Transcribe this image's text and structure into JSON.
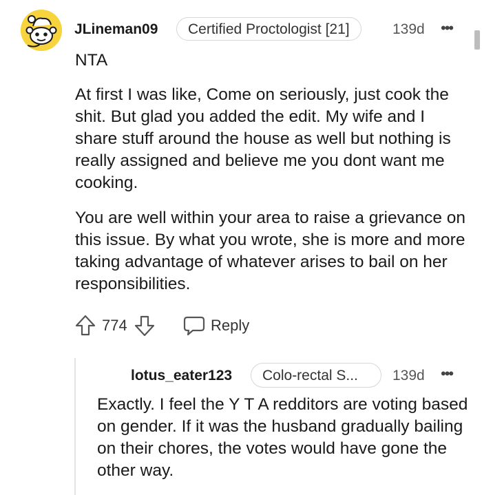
{
  "comment": {
    "username": "JLineman09",
    "flair": "Certified Proctologist [21]",
    "age": "139d",
    "more_label": "•••",
    "paragraphs": [
      "NTA",
      "At first I was like, Come on seriously, just cook the shit. But glad you added the edit. My wife and I share stuff around the house as well but nothing is really assigned and believe me you dont want me cooking.",
      "You are well within your area to raise a grievance on this issue. By what you wrote, she is more and more taking advantage of whatever arises to bail on her responsibilities."
    ],
    "vote_count": "774",
    "reply_label": "Reply",
    "avatar_icon": "snoo-avatar-icon",
    "accent_color": "#f7d33d"
  },
  "reply": {
    "username": "lotus_eater123",
    "flair": "Colo-rectal S...",
    "age": "139d",
    "more_label": "•••",
    "body": "Exactly. I feel the Y T A redditors are voting based on gender. If it was the husband gradually bailing on their chores, the votes would have gone the other way."
  },
  "icons": {
    "upvote": "upvote-arrow-icon",
    "downvote": "downvote-arrow-icon",
    "reply": "speech-bubble-icon"
  }
}
